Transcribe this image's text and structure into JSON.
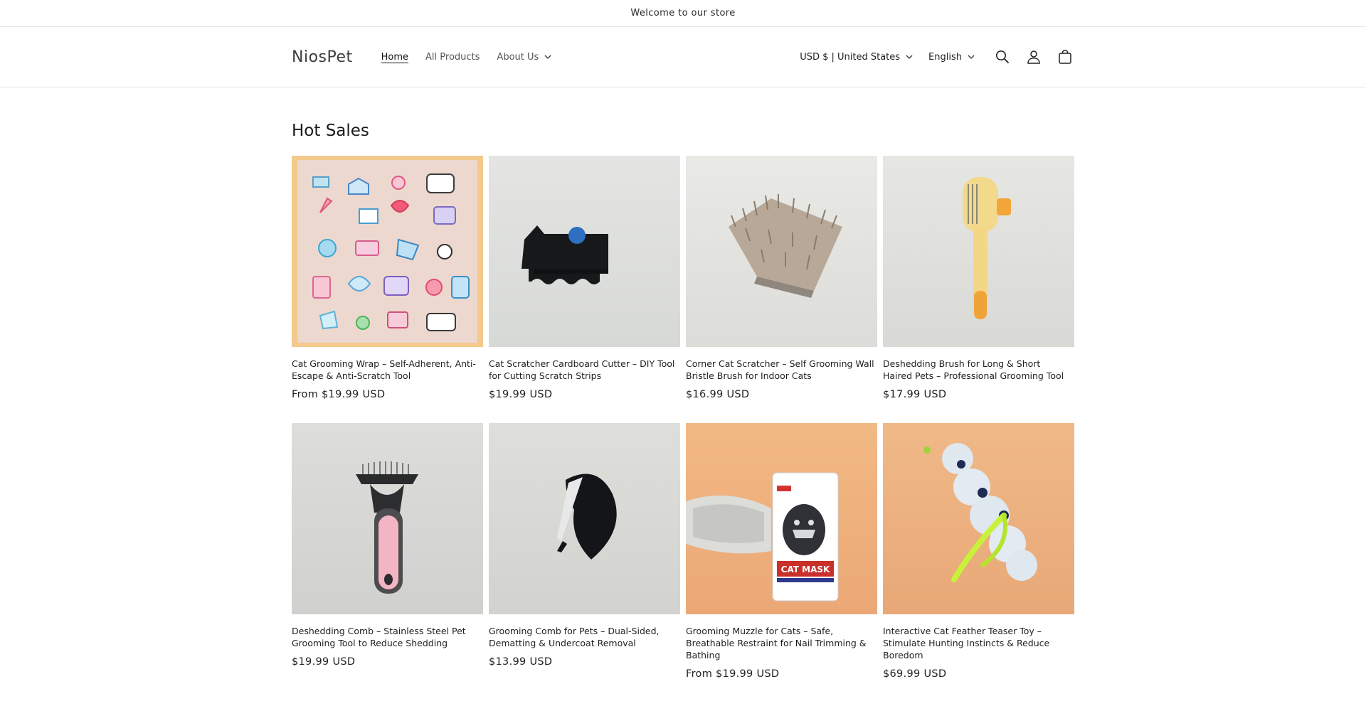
{
  "announcement": "Welcome to our store",
  "header": {
    "logo": "NiosPet",
    "nav": [
      {
        "label": "Home"
      },
      {
        "label": "All Products"
      },
      {
        "label": "About Us"
      }
    ],
    "currency": "USD $ | United States",
    "language": "English"
  },
  "section_title": "Hot Sales",
  "products": [
    {
      "title": "Cat Grooming Wrap – Self-Adherent, Anti-Escape & Anti-Scratch Tool",
      "price": "From $19.99 USD"
    },
    {
      "title": "Cat Scratcher Cardboard Cutter – DIY Tool for Cutting Scratch Strips",
      "price": "$19.99 USD"
    },
    {
      "title": "Corner Cat Scratcher – Self Grooming Wall Bristle Brush for Indoor Cats",
      "price": "$16.99 USD"
    },
    {
      "title": "Deshedding Brush for Long & Short Haired Pets – Professional Grooming Tool",
      "price": "$17.99 USD"
    },
    {
      "title": "Deshedding Comb – Stainless Steel Pet Grooming Tool to Reduce Shedding",
      "price": "$19.99 USD"
    },
    {
      "title": "Grooming Comb for Pets – Dual-Sided, Dematting & Undercoat Removal",
      "price": "$13.99 USD"
    },
    {
      "title": "Grooming Muzzle for Cats – Safe, Breathable Restraint for Nail Trimming & Bathing",
      "price": "From $19.99 USD"
    },
    {
      "title": "Interactive Cat Feather Teaser Toy – Stimulate Hunting Instincts & Reduce Boredom",
      "price": "$69.99 USD"
    }
  ],
  "icons": {
    "search": "search-icon",
    "account": "account-icon",
    "cart": "cart-icon"
  },
  "product_image_text": {
    "muzzle_box_label": "CAT MASK"
  }
}
